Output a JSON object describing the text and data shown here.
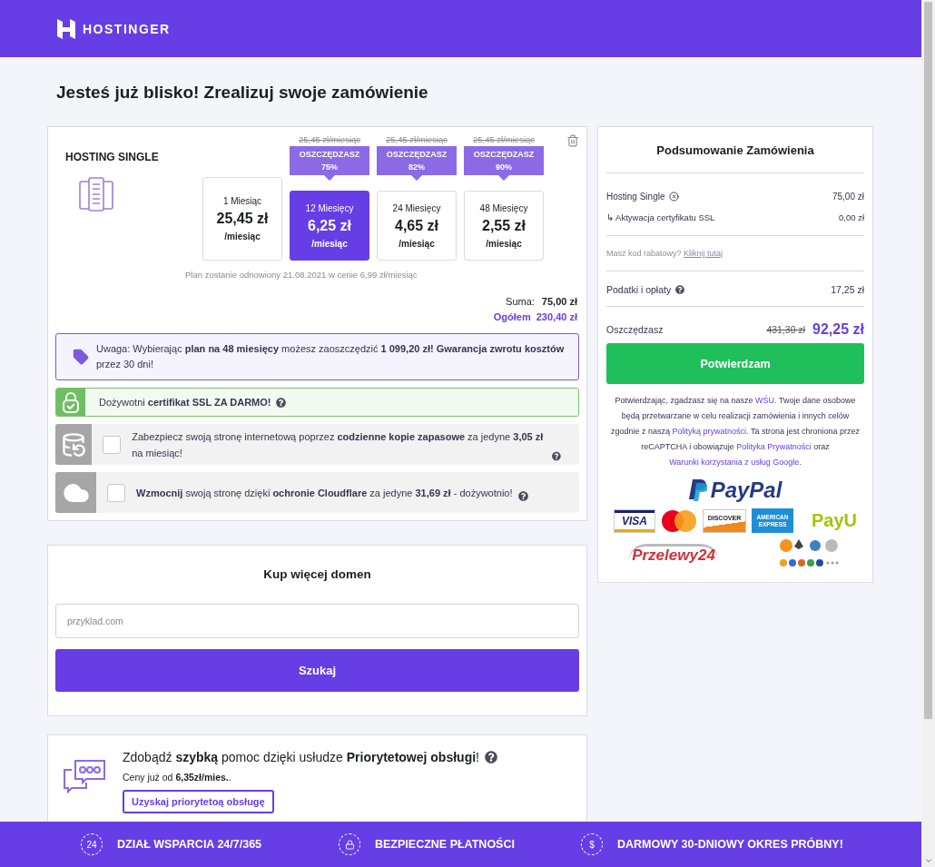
{
  "header": {
    "logo": "HOSTINGER"
  },
  "page_title": "Jesteś już blisko! Zrealizuj swoje zamówienie",
  "product": {
    "name": "HOSTING SINGLE",
    "plans": [
      {
        "period": "1 Miesiąc",
        "price": "25,45 zł",
        "per": "/miesiąc",
        "selected": false
      },
      {
        "period": "12 Miesięcy",
        "price": "6,25 zł",
        "per": "/miesiąc",
        "old_price": "25,45 zł/miesiąc",
        "badge": "OSZCZĘDZASZ",
        "badge_value": "75%",
        "selected": true
      },
      {
        "period": "24 Miesięcy",
        "price": "4,65 zł",
        "per": "/miesiąc",
        "old_price": "25,45 zł/miesiąc",
        "badge": "OSZCZĘDZASZ",
        "badge_value": "82%",
        "selected": false
      },
      {
        "period": "48 Miesięcy",
        "price": "2,55 zł",
        "per": "/miesiąc",
        "old_price": "25,45 zł/miesiąc",
        "badge": "OSZCZĘDZASZ",
        "badge_value": "90%",
        "selected": false
      }
    ],
    "renewal": "Plan zostanie odnowiony 21.08.2021 w cenie 6,99 zł/miesiąc",
    "sum_label": "Suma:",
    "sum": "75,00 zł",
    "total_label": "Ogółem",
    "total": "230,40 zł"
  },
  "notice": "Uwaga: Wybierając **plan na 48 miesięcy** możesz zaoszczędzić **1 099,20 zł! Gwarancja zwrotu kosztów** przez 30 dni!",
  "addons": [
    {
      "kind": "ssl",
      "text": "Dożywotni **certifikat SSL ZA DARMO!**"
    },
    {
      "kind": "backup",
      "text": "Zabezpiecz swoją stronę internetową poprzez **codzienne kopie zapasowe** za jedyne **3,05 zł** na miesiąc!",
      "checked": false
    },
    {
      "kind": "cloudflare",
      "text": "**Wzmocnij** swoją stronę dzięki **ochronie Cloudflare** za jedyne **31,69 zł** - dożywotnio!",
      "checked": false
    }
  ],
  "domains": {
    "title": "Kup więcej domen",
    "placeholder": "przyklad.com",
    "button": "Szukaj"
  },
  "priority": {
    "text": "Zdobądź **szybką** pomoc dzięki usłudze **Priorytetowej obsługi**!",
    "price": "Ceny już od **6,35zł/mies.**.",
    "button": "Uzyskaj priorytetoą obsługę"
  },
  "summary": {
    "title": "Podsumowanie Zamówienia",
    "items": [
      {
        "kind": "item",
        "name": "Hosting Single",
        "price": "75,00 zł"
      },
      {
        "kind": "subitem",
        "name": "↳ Aktywacja certyfikatu SSL",
        "price": "0,00 zł"
      }
    ],
    "coupon": {
      "question": "Masz kod rabatowy?",
      "link": "Kliknij tutaj"
    },
    "taxes": {
      "label": "Podatki i opłaty",
      "value": "17,25 zł"
    },
    "savings": {
      "label": "Oszczędzasz",
      "old": "431,30 zł",
      "value": "92,25 zł"
    },
    "confirm": "Potwierdzam",
    "legal": [
      {
        "text": "Potwierdzając, zgadzasz się na nasze ",
        "link": false
      },
      {
        "text": "WŚU",
        "link": true
      },
      {
        "text": ". Twoje dane osobowe będą przetwarzane w celu realizacji zamówienia i innych celów zgodnie z naszą ",
        "link": false
      },
      {
        "text": "Polityką prywatności",
        "link": true
      },
      {
        "text": ". Ta strona jest chroniona przez reCAPTCHA i obowiązuje ",
        "link": false
      },
      {
        "text": "Polityka Prywatności",
        "link": true
      },
      {
        "text": " oraz ",
        "link": false
      },
      {
        "text": "Warunki korzystania z usług Google",
        "link": true
      },
      {
        "text": ".",
        "link": false
      }
    ],
    "payments": [
      {
        "kind": "paypal",
        "label": "PayPal"
      },
      {
        "kind": "visa",
        "label": "VISA"
      },
      {
        "kind": "circles"
      },
      {
        "kind": "discover",
        "label": "DISCOVER"
      },
      {
        "kind": "amex",
        "label": "AMERICAN EXPRESS"
      },
      {
        "kind": "payu",
        "label": "PayU"
      },
      {
        "kind": "p24",
        "label": "Przelewy24"
      },
      {
        "kind": "crypto"
      }
    ]
  },
  "footer": [
    {
      "kind": "support",
      "icon_text": "24",
      "label": "DZIAŁ WSPARCIA 24/7/365"
    },
    {
      "kind": "lock",
      "label": "BEZPIECZNE PŁATNOŚCI"
    },
    {
      "kind": "money",
      "icon_text": "$",
      "label": "DARMOWY 30-DNIOWY OKRES PRÓBNY!"
    }
  ]
}
